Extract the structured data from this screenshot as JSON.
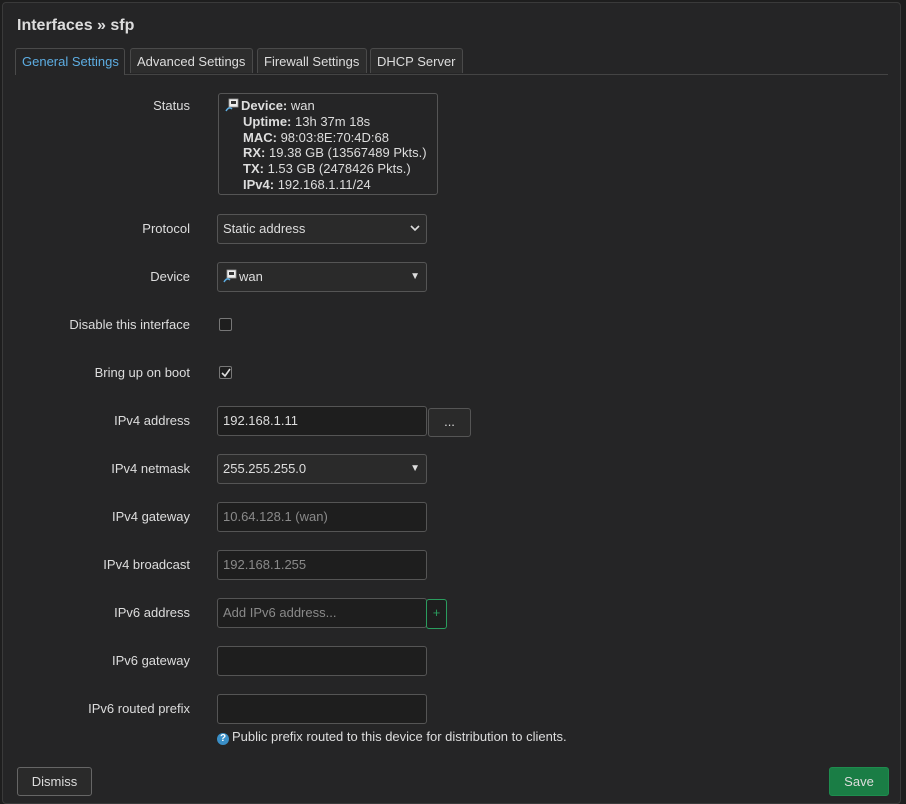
{
  "title": "Interfaces » sfp",
  "tabs": [
    {
      "label": "General Settings",
      "active": true
    },
    {
      "label": "Advanced Settings",
      "active": false
    },
    {
      "label": "Firewall Settings",
      "active": false
    },
    {
      "label": "DHCP Server",
      "active": false
    }
  ],
  "status": {
    "label": "Status",
    "device_label": "Device:",
    "device": "wan",
    "uptime_label": "Uptime:",
    "uptime": "13h 37m 18s",
    "mac_label": "MAC:",
    "mac": "98:03:8E:70:4D:68",
    "rx_label": "RX:",
    "rx": "19.38 GB (13567489 Pkts.)",
    "tx_label": "TX:",
    "tx": "1.53 GB (2478426 Pkts.)",
    "ipv4_label": "IPv4:",
    "ipv4": "192.168.1.11/24"
  },
  "protocol": {
    "label": "Protocol",
    "value": "Static address"
  },
  "device": {
    "label": "Device",
    "value": "wan"
  },
  "disable_interface": {
    "label": "Disable this interface",
    "checked": false
  },
  "bring_up_on_boot": {
    "label": "Bring up on boot",
    "checked": true
  },
  "ipv4_address": {
    "label": "IPv4 address",
    "value": "192.168.1.11",
    "more_button": "..."
  },
  "ipv4_netmask": {
    "label": "IPv4 netmask",
    "value": "255.255.255.0"
  },
  "ipv4_gateway": {
    "label": "IPv4 gateway",
    "placeholder": "10.64.128.1 (wan)"
  },
  "ipv4_broadcast": {
    "label": "IPv4 broadcast",
    "placeholder": "192.168.1.255"
  },
  "ipv6_address": {
    "label": "IPv6 address",
    "placeholder": "Add IPv6 address...",
    "add_button": "+"
  },
  "ipv6_gateway": {
    "label": "IPv6 gateway",
    "value": ""
  },
  "ipv6_routed_prefix": {
    "label": "IPv6 routed prefix",
    "value": "",
    "help": "Public prefix routed to this device for distribution to clients."
  },
  "buttons": {
    "dismiss": "Dismiss",
    "save": "Save"
  },
  "colors": {
    "accent": "#5dade2",
    "save": "#1a7d45",
    "add": "#2a9d5e",
    "help_icon": "#3a8fc7"
  }
}
